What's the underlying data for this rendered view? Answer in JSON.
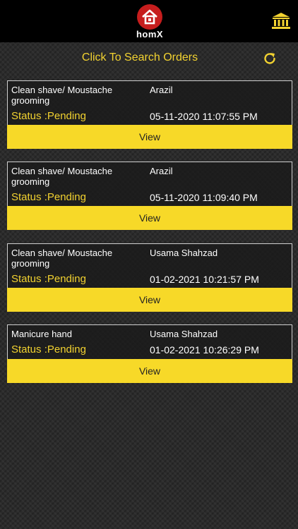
{
  "header": {
    "logo_text": "homX",
    "logo_icon": "home-icon",
    "bank_icon": "bank-icon",
    "accent_color": "#f2d230",
    "logo_color": "#c61d1d"
  },
  "search": {
    "label": "Click To Search Orders",
    "refresh_icon": "refresh-icon"
  },
  "orders": [
    {
      "service": "Clean shave/ Moustache grooming",
      "customer": "Arazil",
      "status": "Status :Pending",
      "datetime": "05-11-2020 11:07:55 PM",
      "action": "View"
    },
    {
      "service": "Clean shave/ Moustache grooming",
      "customer": "Arazil",
      "status": "Status :Pending",
      "datetime": "05-11-2020 11:09:40 PM",
      "action": "View"
    },
    {
      "service": "Clean shave/ Moustache grooming",
      "customer": "Usama Shahzad",
      "status": "Status :Pending",
      "datetime": "01-02-2021 10:21:57 PM",
      "action": "View"
    },
    {
      "service": "Manicure hand",
      "customer": "Usama Shahzad",
      "status": "Status :Pending",
      "datetime": "01-02-2021 10:26:29 PM",
      "action": "View"
    }
  ]
}
